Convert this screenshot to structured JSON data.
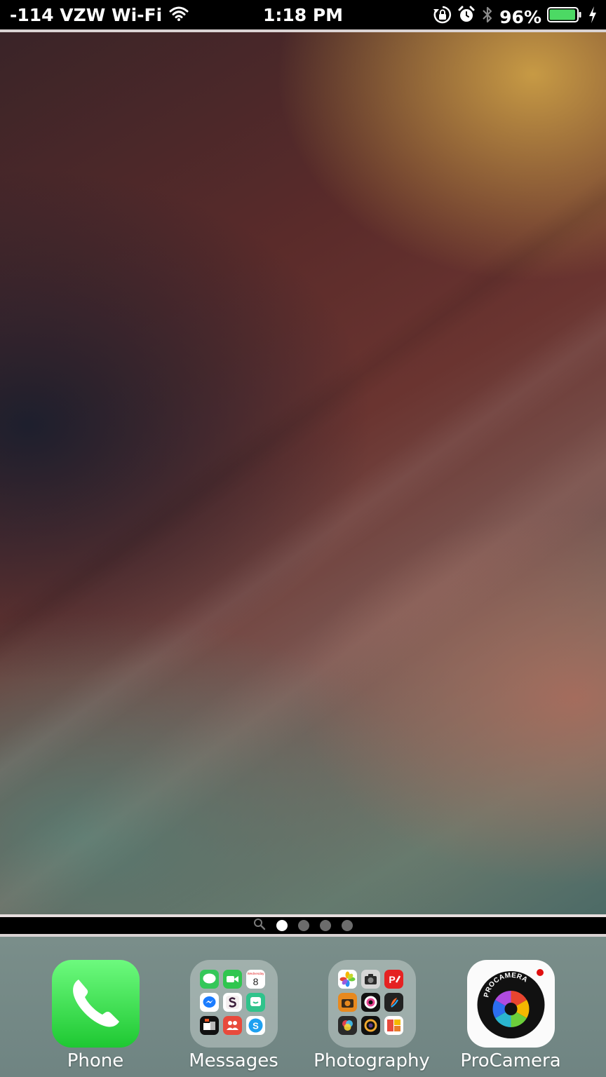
{
  "status_bar": {
    "carrier": "-114 VZW Wi-Fi",
    "time": "1:18 PM",
    "battery_percent": "96%",
    "battery_level": 0.96,
    "icons": [
      "wifi-icon",
      "orientation-lock-icon",
      "alarm-icon",
      "bluetooth-icon",
      "battery-icon",
      "charging-bolt-icon"
    ]
  },
  "page_indicator": {
    "pages": 4,
    "current": 1,
    "icons": [
      "spotlight-search-icon"
    ]
  },
  "dock": {
    "apps": [
      {
        "label": "Phone",
        "icon": "phone-icon",
        "color": "#26d63b"
      },
      {
        "label": "Messages",
        "icon": "folder-icon"
      },
      {
        "label": "Photography",
        "icon": "folder-icon"
      },
      {
        "label": "ProCamera",
        "icon": "procamera-icon",
        "badge_color": "#e01010"
      }
    ],
    "messages_folder_apps": [
      "messages-icon",
      "facetime-icon",
      "calendar-icon",
      "messenger-icon",
      "slack-icon",
      "groupme-icon",
      "office-lens-icon",
      "family-icon",
      "skype-icon"
    ],
    "calendar_mini": {
      "weekday": "Wednesday",
      "day": "8"
    },
    "photography_folder_apps": [
      "photos-icon",
      "camera-icon",
      "adobe-post-icon",
      "camera-plus-icon",
      "lens-app-icon",
      "pencil-app-icon",
      "filter-app-icon",
      "halide-icon",
      "collage-app-icon"
    ]
  }
}
